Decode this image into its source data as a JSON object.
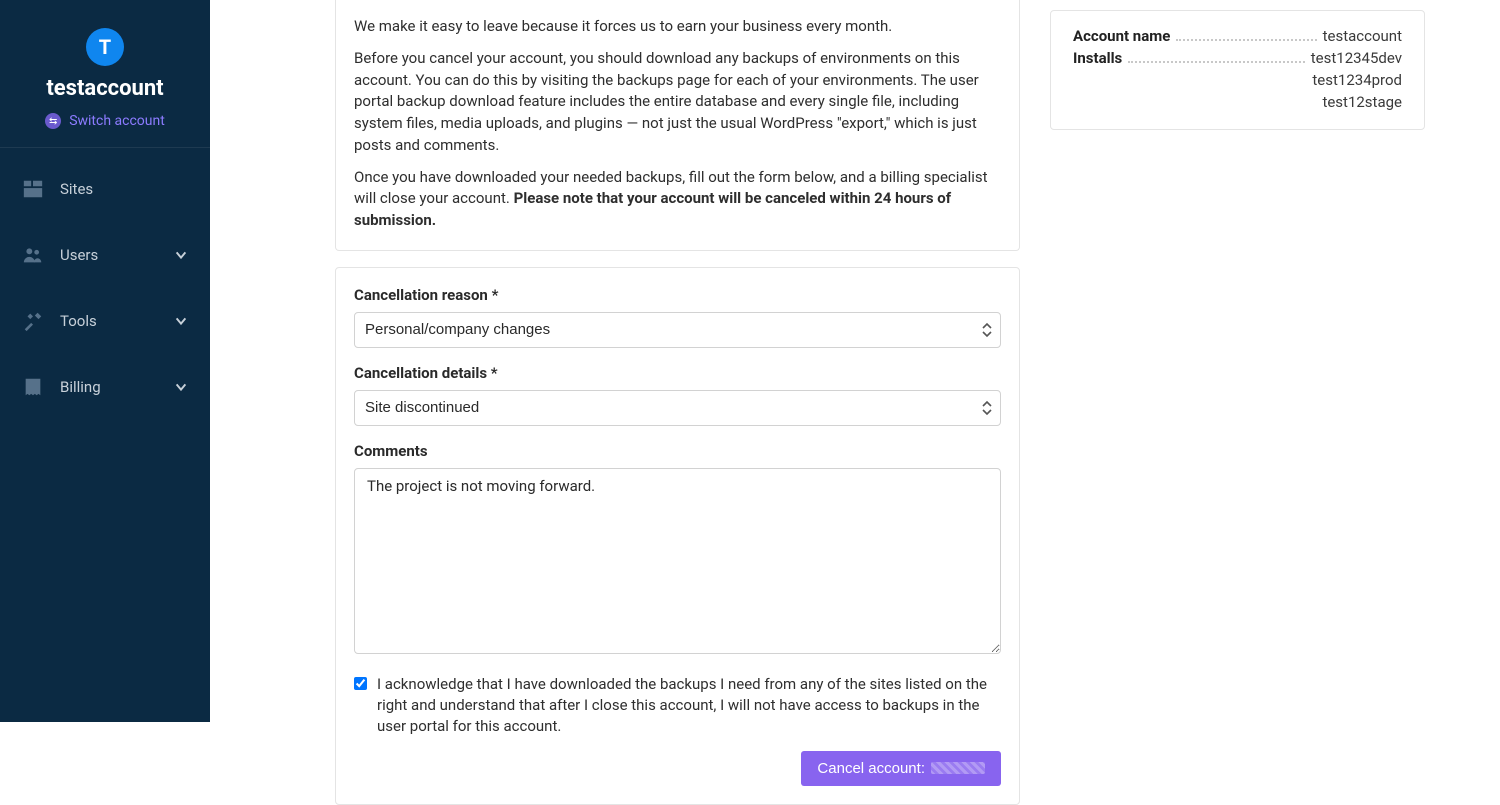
{
  "sidebar": {
    "avatar_initial": "T",
    "account_name": "testaccount",
    "switch_label": "Switch account",
    "items": [
      {
        "label": "Sites",
        "expandable": false
      },
      {
        "label": "Users",
        "expandable": true
      },
      {
        "label": "Tools",
        "expandable": true
      },
      {
        "label": "Billing",
        "expandable": true
      }
    ]
  },
  "info": {
    "p1": "We make it easy to leave because it forces us to earn your business every month.",
    "p2": "Before you cancel your account, you should download any backups of environments on this account. You can do this by visiting the backups page for each of your environments. The user portal backup download feature includes the entire database and every single file, including system files, media uploads, and plugins — not just the usual WordPress \"export,\" which is just posts and comments.",
    "p3_prefix": "Once you have downloaded your needed backups, fill out the form below, and a billing specialist will close your account. ",
    "p3_bold": "Please note that your account will be canceled within 24 hours of submission."
  },
  "form": {
    "reason_label": "Cancellation reason *",
    "reason_value": "Personal/company changes",
    "details_label": "Cancellation details *",
    "details_value": "Site discontinued",
    "comments_label": "Comments",
    "comments_value": "The project is not moving forward.",
    "ack_checked": true,
    "ack_text": "I acknowledge that I have downloaded the backups I need from any of the sites listed on the right and understand that after I close this account, I will not have access to backups in the user portal for this account.",
    "cancel_button_label": "Cancel account:"
  },
  "panel": {
    "account_name_key": "Account name",
    "account_name_value": "testaccount",
    "installs_key": "Installs",
    "installs": [
      "test12345dev",
      "test1234prod",
      "test12stage"
    ]
  }
}
